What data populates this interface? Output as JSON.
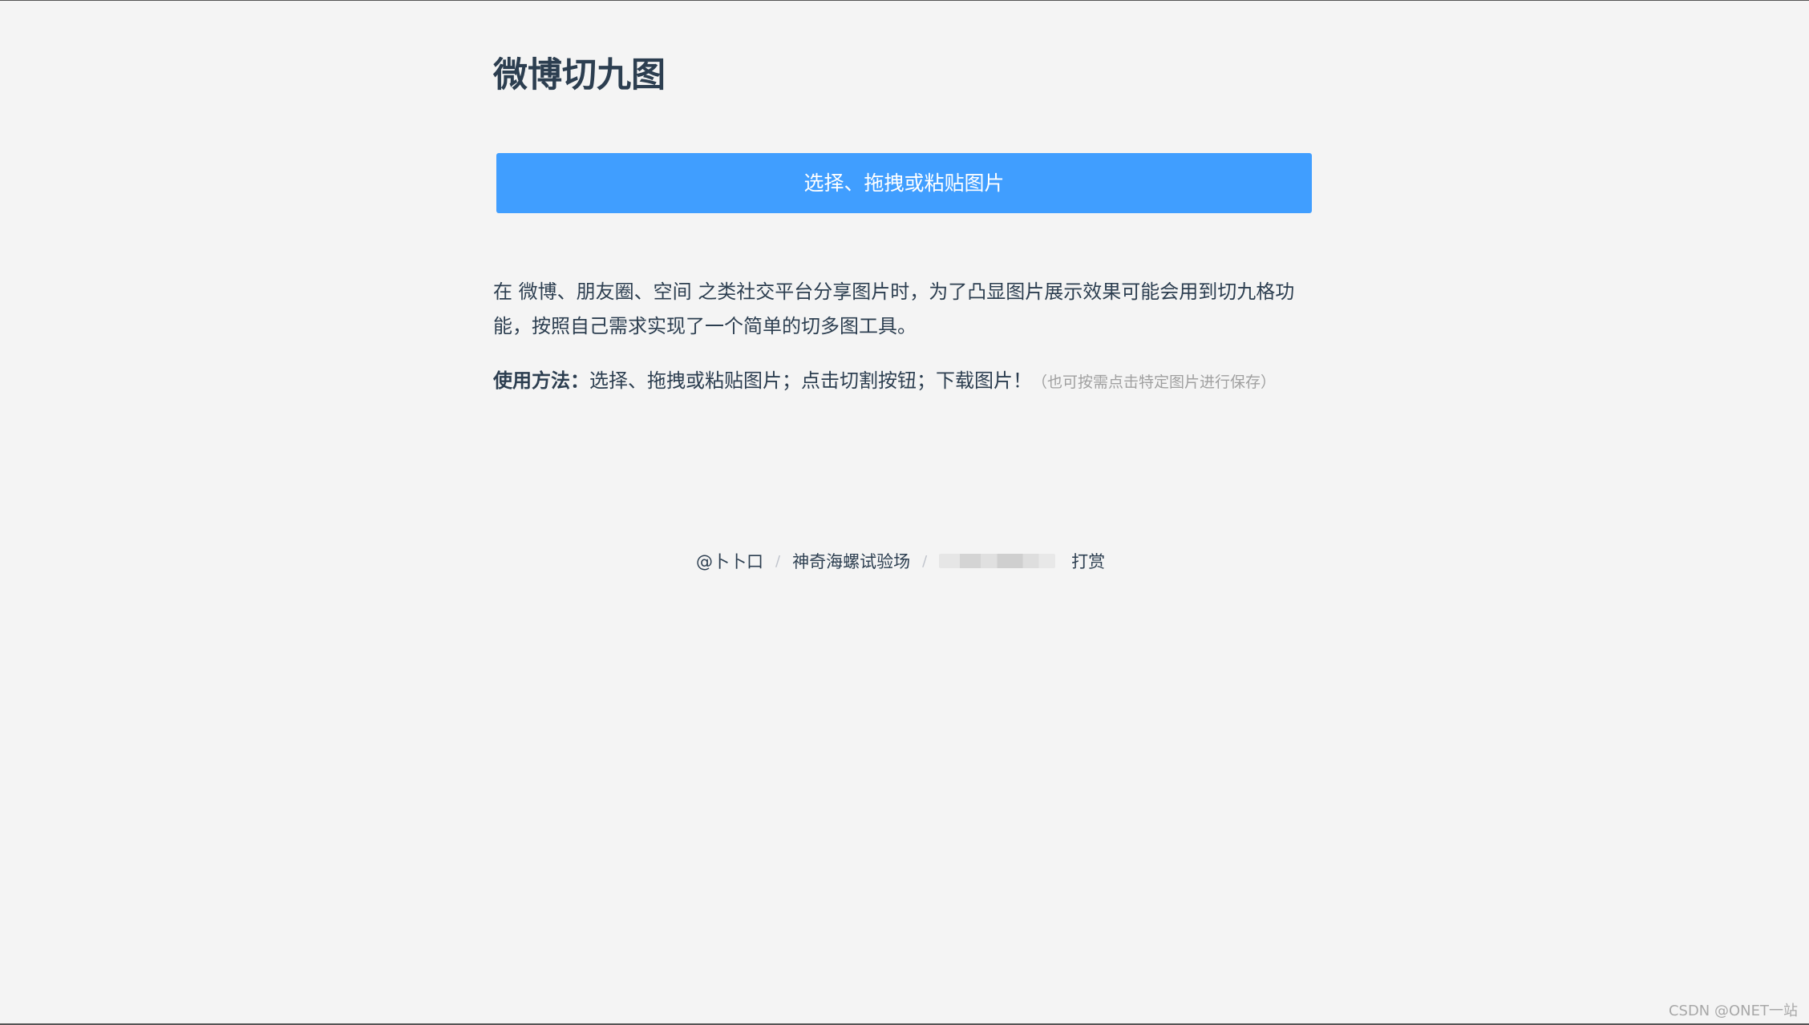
{
  "header": {
    "title": "微博切九图"
  },
  "upload": {
    "button_label": "选择、拖拽或粘贴图片"
  },
  "intro": {
    "description": "在 微博、朋友圈、空间 之类社交平台分享图片时，为了凸显图片展示效果可能会用到切九格功能，按照自己需求实现了一个简单的切多图工具。"
  },
  "usage": {
    "label": "使用方法：",
    "steps": "选择、拖拽或粘贴图片；点击切割按钮；下载图片！",
    "note": "（也可按需点击特定图片进行保存）"
  },
  "footer": {
    "author": "@卜卜口",
    "separator": "/",
    "site": "神奇海螺试验场",
    "donate": "打赏"
  },
  "watermark": {
    "text": "CSDN @ONET一站"
  }
}
